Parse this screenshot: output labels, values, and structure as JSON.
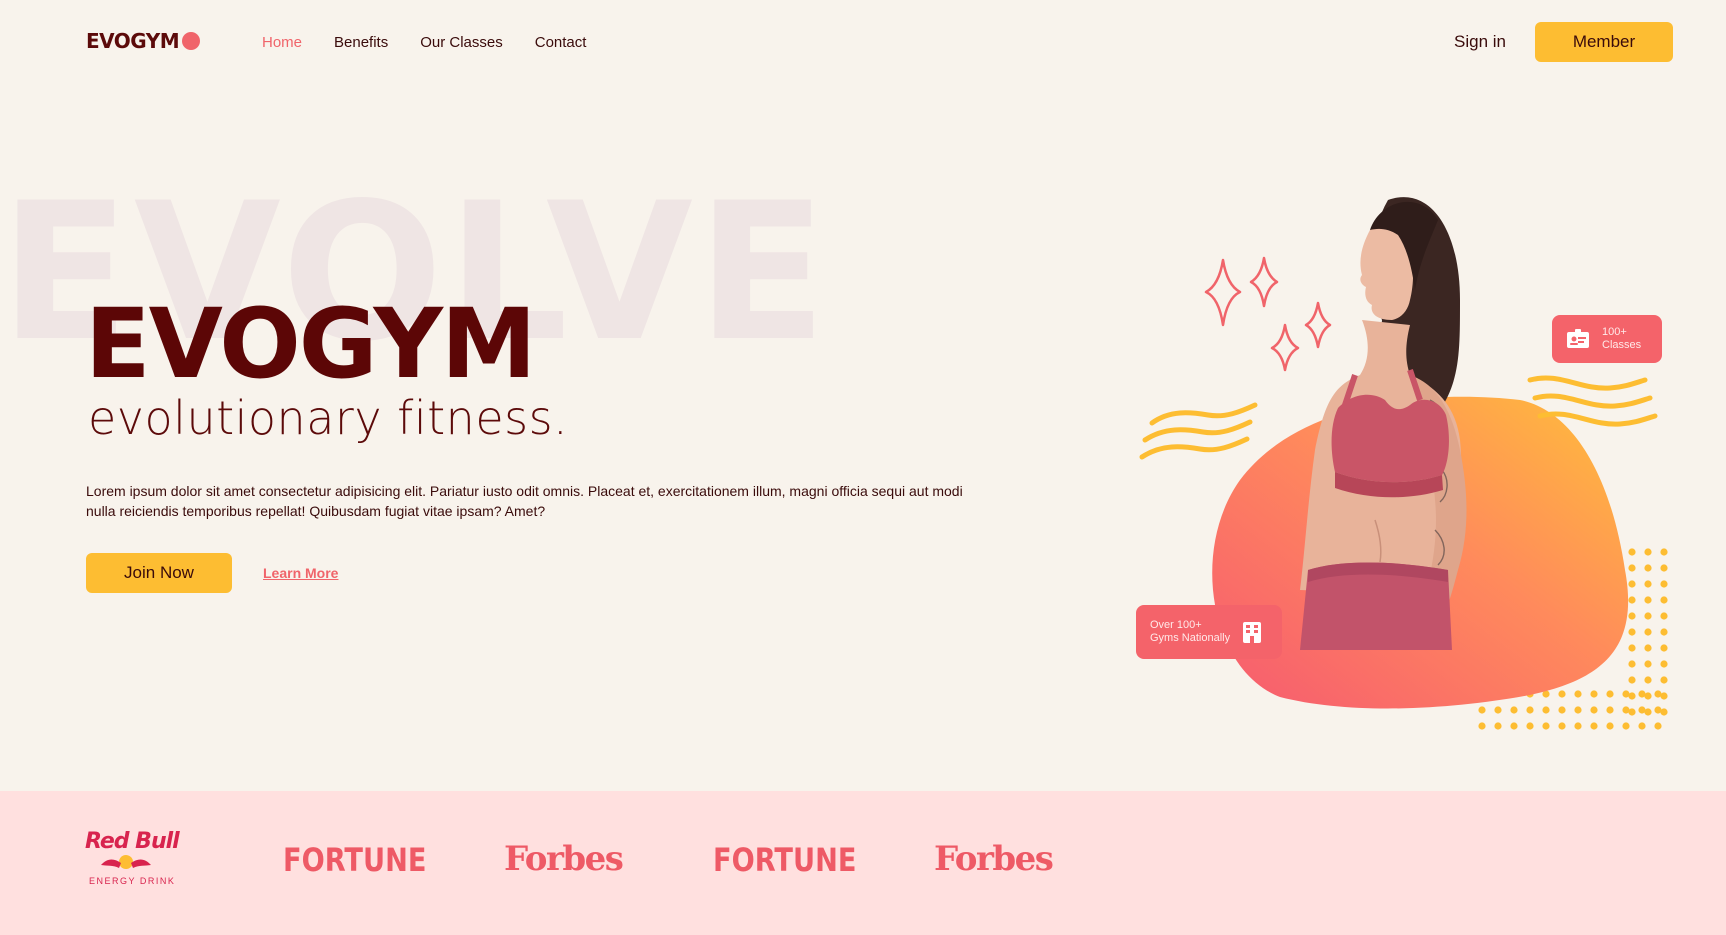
{
  "nav": {
    "logo": "EVOGYM",
    "links": [
      "Home",
      "Benefits",
      "Our Classes",
      "Contact"
    ],
    "sign_in": "Sign in",
    "member": "Member"
  },
  "hero": {
    "background_word": "EVOLVE",
    "title": "EVOGYM",
    "subtitle": "evolutionary fitness.",
    "description": "Lorem ipsum dolor sit amet consectetur adipisicing elit. Pariatur iusto odit omnis. Placeat et, exercitationem illum, magni officia sequi aut modi nulla reiciendis temporibus repellat! Quibusdam fugiat vitae ipsam? Amet?",
    "join_label": "Join Now",
    "learn_label": "Learn More"
  },
  "badges": {
    "classes": [
      "100+",
      "Classes"
    ],
    "gyms": [
      "Over 100+",
      "Gyms Nationally"
    ]
  },
  "partners": {
    "redbull": [
      "Red Bull",
      "ENERGY DRINK"
    ],
    "fortune": "FORTUNE",
    "forbes": "Forbes"
  },
  "colors": {
    "background": "#f8f3ec",
    "primary_dark": "#5c0606",
    "accent_coral": "#f0646a",
    "accent_yellow": "#fdbd32",
    "partners_bg": "#ffe0df"
  },
  "icons": [
    "profile-card-icon",
    "building-icon",
    "sparkle-icon"
  ]
}
